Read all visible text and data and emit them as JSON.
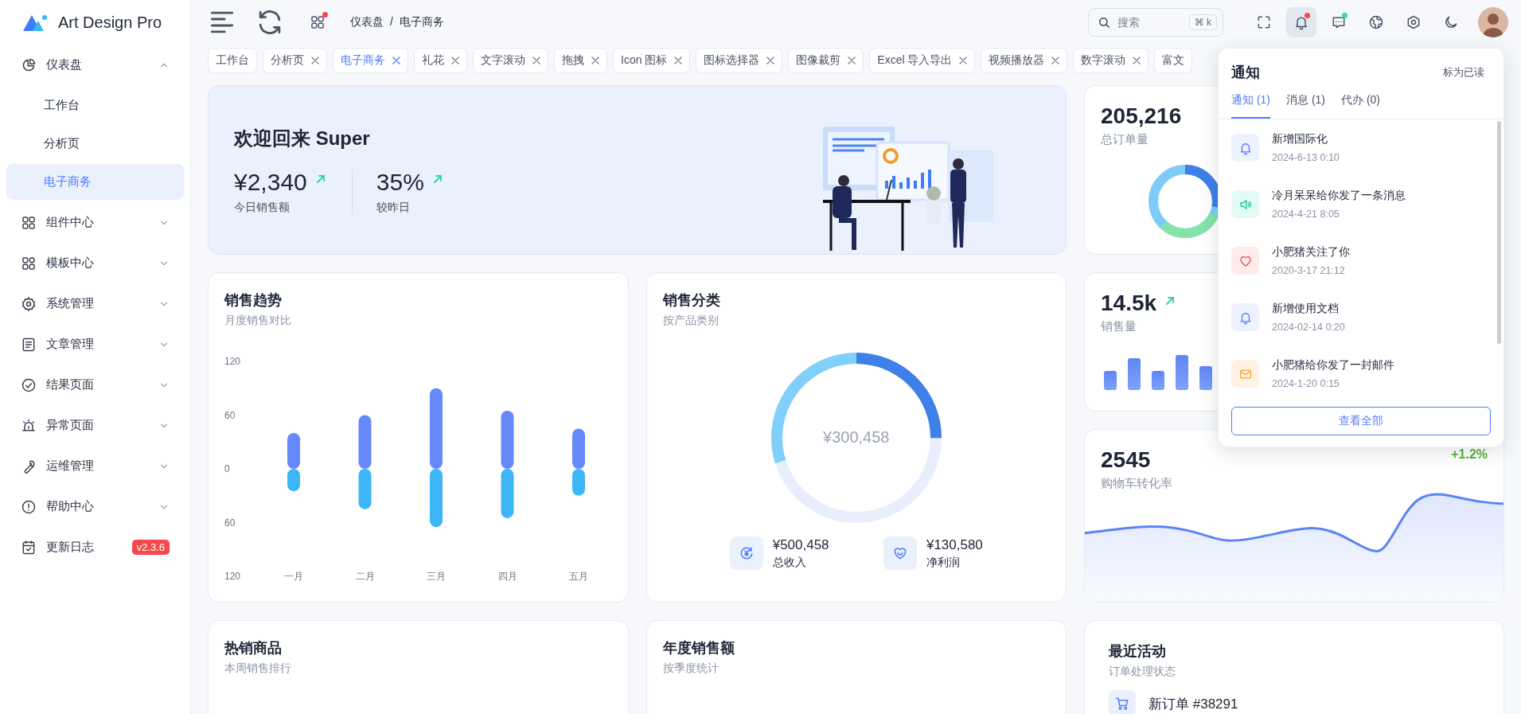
{
  "sidebar": {
    "logo": "Art Design Pro",
    "items": [
      {
        "label": "仪表盘",
        "expanded": true,
        "children": [
          {
            "label": "工作台",
            "selected": false
          },
          {
            "label": "分析页",
            "selected": false
          },
          {
            "label": "电子商务",
            "selected": true
          }
        ]
      },
      {
        "label": "组件中心",
        "expanded": false
      },
      {
        "label": "模板中心",
        "expanded": false
      },
      {
        "label": "系统管理",
        "expanded": false
      },
      {
        "label": "文章管理",
        "expanded": false
      },
      {
        "label": "结果页面",
        "expanded": false
      },
      {
        "label": "异常页面",
        "expanded": false
      },
      {
        "label": "运维管理",
        "expanded": false
      },
      {
        "label": "帮助中心",
        "expanded": false
      },
      {
        "label": "更新日志",
        "badge": "v2.3.6"
      }
    ]
  },
  "topbar": {
    "breadcrumb": [
      {
        "label": "仪表盘"
      },
      {
        "label": "电子商务"
      }
    ],
    "breadcrumb_separator": "/",
    "apps_dot": true,
    "search": {
      "placeholder": "搜索",
      "shortcut": "⌘ k"
    },
    "tools": [
      {
        "kind": "fullscreen",
        "active": false
      },
      {
        "kind": "bell",
        "active": true,
        "color": "#f5484c"
      },
      {
        "kind": "chat",
        "active": false,
        "color": "#3fd3b4"
      },
      {
        "kind": "globe",
        "active": false
      },
      {
        "kind": "settings",
        "active": false
      },
      {
        "kind": "moon",
        "active": false
      }
    ]
  },
  "tabs": [
    {
      "label": "工作台",
      "selected": false,
      "closable": false
    },
    {
      "label": "分析页",
      "selected": false,
      "closable": true
    },
    {
      "label": "电子商务",
      "selected": true,
      "closable": true
    },
    {
      "label": "礼花",
      "selected": false,
      "closable": true
    },
    {
      "label": "文字滚动",
      "selected": false,
      "closable": true
    },
    {
      "label": "拖拽",
      "selected": false,
      "closable": true
    },
    {
      "label": "Icon 图标",
      "selected": false,
      "closable": true
    },
    {
      "label": "图标选择器",
      "selected": false,
      "closable": true
    },
    {
      "label": "图像裁剪",
      "selected": false,
      "closable": true
    },
    {
      "label": "Excel 导入导出",
      "selected": false,
      "closable": true
    },
    {
      "label": "视频播放器",
      "selected": false,
      "closable": true
    },
    {
      "label": "数字滚动",
      "selected": false,
      "closable": true
    },
    {
      "label": "富文",
      "selected": false,
      "closable": false
    }
  ],
  "welcome": {
    "title": "欢迎回来 Super",
    "stats": [
      {
        "value": "¥2,340",
        "label": "今日销售额",
        "trend_up": true
      },
      {
        "value": "35%",
        "label": "较昨日",
        "trend_up": true
      }
    ]
  },
  "orders_card": {
    "value": "205,216",
    "label": "总订单量"
  },
  "sales_trend": {
    "title": "销售趋势",
    "subtitle": "月度销售对比",
    "chart_data": {
      "type": "bar",
      "categories": [
        "一月",
        "二月",
        "三月",
        "四月",
        "五月"
      ],
      "stacked": true,
      "ylim": [
        -120,
        120
      ],
      "yticks": [
        {
          "value": 120,
          "label": "120"
        },
        {
          "value": 60,
          "label": "60"
        },
        {
          "value": 0,
          "label": "0"
        },
        {
          "value": -60,
          "label": "60"
        },
        {
          "value": -120,
          "label": "120"
        }
      ],
      "series": [
        {
          "color": "#6589fb",
          "values": [
            40,
            60,
            90,
            65,
            45
          ]
        },
        {
          "color": "#3db6f8",
          "values": [
            -25,
            -45,
            -65,
            -55,
            -30
          ]
        }
      ]
    }
  },
  "sales_category": {
    "title": "销售分类",
    "subtitle": "按产品类别",
    "center": "¥300,458",
    "stats": [
      {
        "kind": "income",
        "value": "¥500,458",
        "label": "总收入"
      },
      {
        "kind": "profit",
        "value": "¥130,580",
        "label": "净利润"
      }
    ]
  },
  "sales_volume": {
    "value": "14.5k",
    "label": "销售量",
    "trend_up": true
  },
  "cart": {
    "value": "2545",
    "label": "购物车转化率",
    "change": "+1.2%"
  },
  "hot_products": {
    "title": "热销商品",
    "subtitle": "本周销售排行"
  },
  "yearly_sales": {
    "title": "年度销售额",
    "subtitle": "按季度统计"
  },
  "activity": {
    "title": "最近活动",
    "subtitle": "订单处理状态",
    "items": [
      {
        "title": "新订单 #38291"
      }
    ]
  },
  "notifications": {
    "title": "通知",
    "mark_read": "标为已读",
    "tabs": [
      {
        "label": "通知 (1)",
        "selected": true
      },
      {
        "label": "消息 (1)",
        "selected": false
      },
      {
        "label": "代办 (0)",
        "selected": false
      }
    ],
    "items": [
      {
        "kind": "bell",
        "title": "新增国际化",
        "time": "2024-6-13 0:10"
      },
      {
        "kind": "speaker",
        "title": "冷月呆呆给你发了一条消息",
        "time": "2024-4-21 8:05"
      },
      {
        "kind": "heart",
        "title": "小肥猪关注了你",
        "time": "2020-3-17 21:12"
      },
      {
        "kind": "bell",
        "title": "新增使用文档",
        "time": "2024-02-14 0:20"
      },
      {
        "kind": "mail",
        "title": "小肥猪给你发了一封邮件",
        "time": "2024-1-20 0:15"
      }
    ],
    "view_all": "查看全部"
  }
}
